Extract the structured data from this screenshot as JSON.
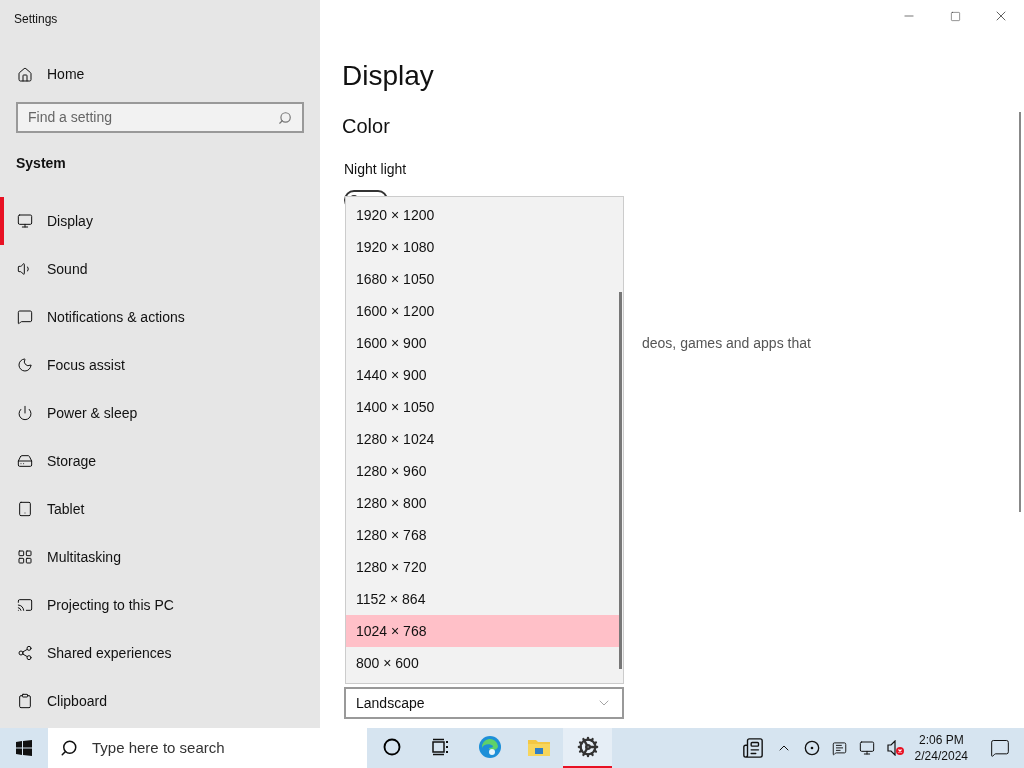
{
  "window": {
    "title": "Settings"
  },
  "sidebar": {
    "home": "Home",
    "search": {
      "placeholder": "Find a setting"
    },
    "section": "System",
    "items": [
      {
        "kind": "display",
        "label": "Display",
        "selected": true
      },
      {
        "kind": "sound",
        "label": "Sound",
        "selected": false
      },
      {
        "kind": "notifications",
        "label": "Notifications & actions",
        "selected": false
      },
      {
        "kind": "focus",
        "label": "Focus assist",
        "selected": false
      },
      {
        "kind": "power",
        "label": "Power & sleep",
        "selected": false
      },
      {
        "kind": "storage",
        "label": "Storage",
        "selected": false
      },
      {
        "kind": "tablet",
        "label": "Tablet",
        "selected": false
      },
      {
        "kind": "multitasking",
        "label": "Multitasking",
        "selected": false
      },
      {
        "kind": "projecting",
        "label": "Projecting to this PC",
        "selected": false
      },
      {
        "kind": "shared",
        "label": "Shared experiences",
        "selected": false
      },
      {
        "kind": "clipboard",
        "label": "Clipboard",
        "selected": false
      }
    ]
  },
  "main": {
    "title": "Display",
    "section": "Color",
    "night_light": {
      "label": "Night light",
      "on": false
    },
    "partial_text": "deos, games and apps that",
    "resolution_dropdown": {
      "options": [
        {
          "label": "1920 × 1200",
          "selected": false
        },
        {
          "label": "1920 × 1080",
          "selected": false
        },
        {
          "label": "1680 × 1050",
          "selected": false
        },
        {
          "label": "1600 × 1200",
          "selected": false
        },
        {
          "label": "1600 × 900",
          "selected": false
        },
        {
          "label": "1440 × 900",
          "selected": false
        },
        {
          "label": "1400 × 1050",
          "selected": false
        },
        {
          "label": "1280 × 1024",
          "selected": false
        },
        {
          "label": "1280 × 960",
          "selected": false
        },
        {
          "label": "1280 × 800",
          "selected": false
        },
        {
          "label": "1280 × 768",
          "selected": false
        },
        {
          "label": "1280 × 720",
          "selected": false
        },
        {
          "label": "1152 × 864",
          "selected": false
        },
        {
          "label": "1024 × 768",
          "selected": true
        },
        {
          "label": "800 × 600",
          "selected": false
        }
      ]
    },
    "orientation": {
      "value": "Landscape"
    }
  },
  "taskbar": {
    "search": {
      "placeholder": "Type here to search"
    },
    "apps": [
      {
        "kind": "cortana",
        "selected": false
      },
      {
        "kind": "taskview",
        "selected": false
      },
      {
        "kind": "edge",
        "selected": false
      },
      {
        "kind": "explorer",
        "selected": false
      },
      {
        "kind": "settings",
        "selected": true
      }
    ],
    "time": "2:06 PM",
    "date": "2/24/2024"
  }
}
